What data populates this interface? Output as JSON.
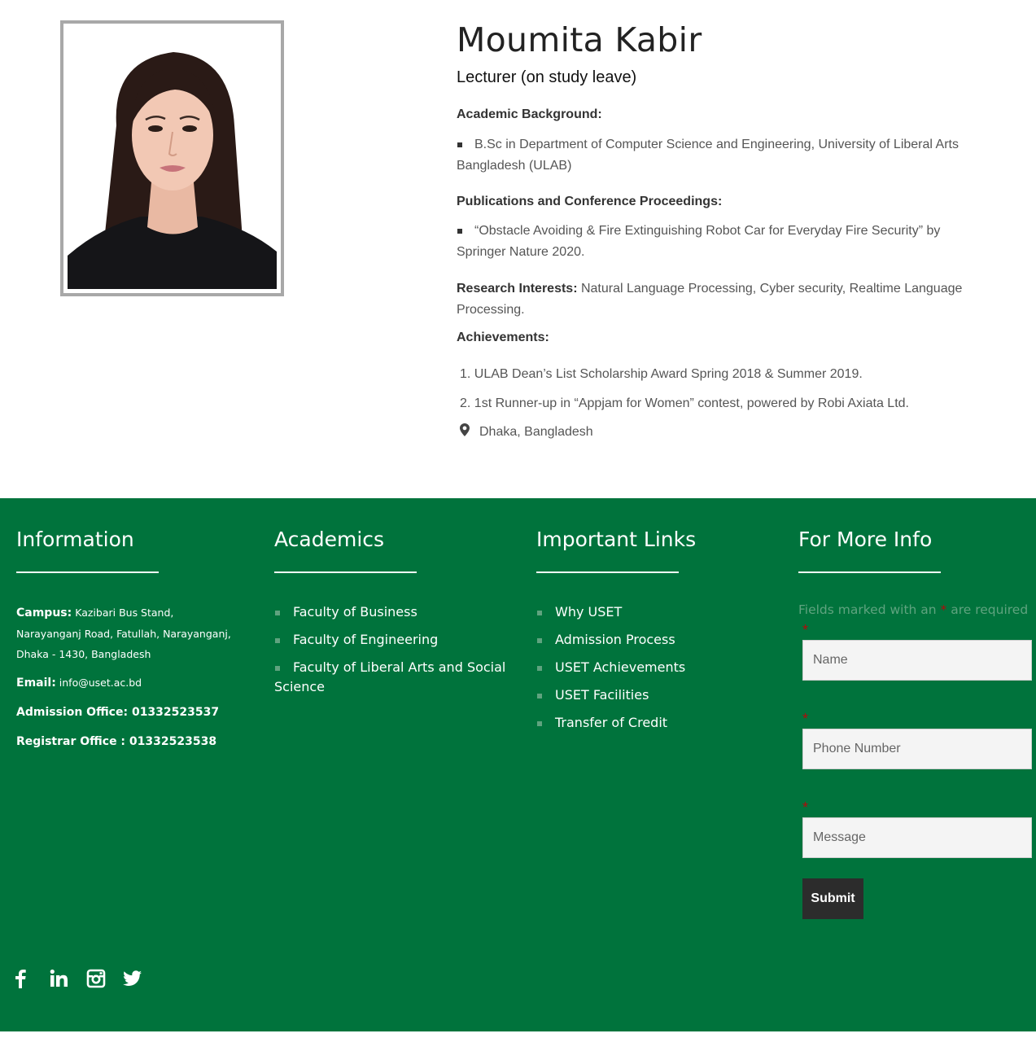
{
  "profile": {
    "name": "Moumita Kabir",
    "position": "Lecturer (on study leave)",
    "academic_heading": "Academic Background:",
    "academic_items": [
      "B.Sc in Department of Computer Science and Engineering, University of Liberal Arts Bangladesh (ULAB)"
    ],
    "publications_heading": "Publications and Conference Proceedings:",
    "publications_items": [
      "“Obstacle Avoiding & Fire Extinguishing Robot Car for Everyday Fire Security” by Springer Nature 2020."
    ],
    "research_heading": "Research Interests:",
    "research_text": "Natural Language Processing, Cyber security, Realtime Language Processing.",
    "achievements_heading": "Achievements:",
    "achievements": [
      "1. ULAB Dean’s List Scholarship Award Spring 2018 & Summer 2019.",
      "2. 1st Runner-up in “Appjam for Women” contest, powered by Robi Axiata Ltd."
    ],
    "location_icon": "map-marker-icon",
    "location": "Dhaka, Bangladesh"
  },
  "footer": {
    "background_color": "#00733c",
    "information": {
      "heading": "Information",
      "campus_label": "Campus:",
      "campus_value": "Kazibari Bus Stand, Narayanganj Road, Fatullah, Narayanganj, Dhaka - 1430, Bangladesh",
      "email_label": "Email:",
      "email_value": "info@uset.ac.bd",
      "admission": "Admission Office: 01332523537",
      "registrar": "Registrar Office : 01332523538"
    },
    "academics": {
      "heading": "Academics",
      "links": [
        "Faculty of Business",
        "Faculty of Engineering",
        "Faculty of Liberal Arts and Social Science"
      ]
    },
    "important_links": {
      "heading": "Important Links",
      "links": [
        "Why USET",
        "Admission Process",
        "USET Achievements",
        "USET Facilities",
        "Transfer of Credit"
      ]
    },
    "more_info": {
      "heading": "For More Info",
      "note_prefix": "Fields marked with an",
      "note_star": "*",
      "note_suffix": "are required",
      "required_star": "*",
      "name_placeholder": "Name",
      "phone_placeholder": "Phone Number",
      "message_placeholder": "Message",
      "submit_label": "Submit"
    },
    "social_icons": [
      "facebook-icon",
      "linkedin-icon",
      "instagram-icon",
      "twitter-icon"
    ]
  }
}
